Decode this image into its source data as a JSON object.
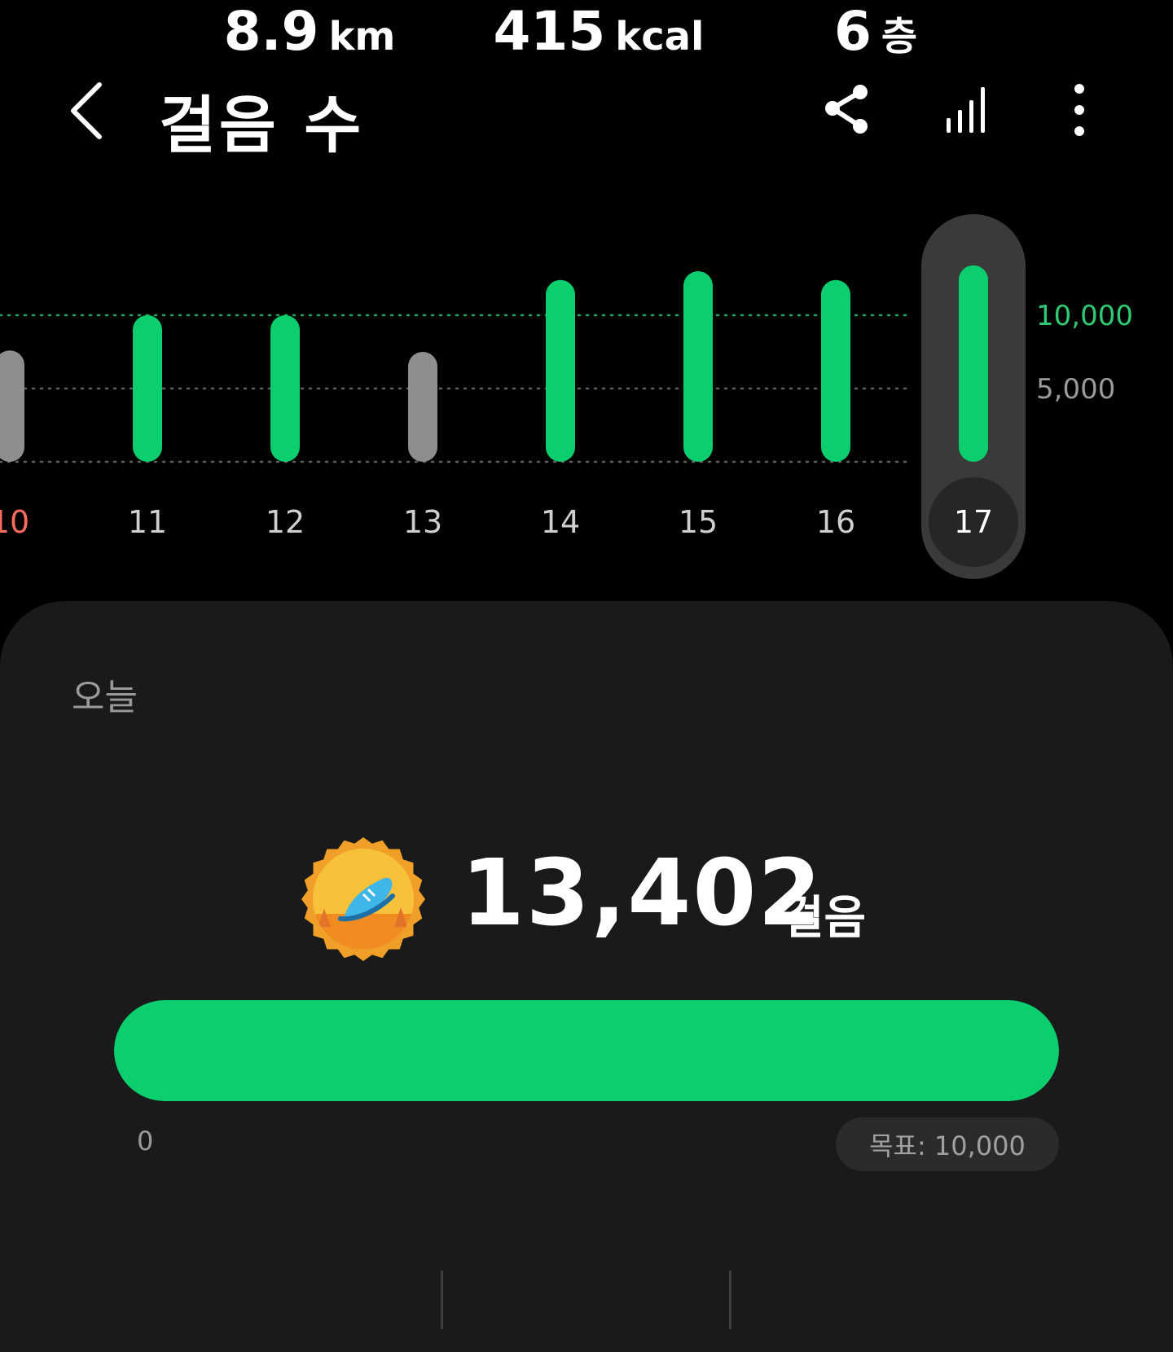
{
  "header": {
    "title": "걸음 수",
    "back_icon": "back-arrow-icon",
    "share_icon": "share-icon",
    "chart_icon": "bar-chart-icon",
    "more_icon": "more-vertical-icon"
  },
  "chart_data": {
    "type": "bar",
    "categories": [
      "10",
      "11",
      "12",
      "13",
      "14",
      "15",
      "16",
      "17"
    ],
    "values": [
      7600,
      10000,
      10000,
      7500,
      12400,
      13000,
      12400,
      13402
    ],
    "goal": 10000,
    "goal_met": [
      false,
      true,
      true,
      false,
      true,
      true,
      true,
      true
    ],
    "selected_index": 7,
    "y_tick_labels": [
      "10,000",
      "5,000"
    ],
    "y_ticks": [
      10000,
      5000,
      0
    ],
    "colors": {
      "goal_met": "#0bcf6e",
      "goal_missed": "#8e8e8e",
      "goal_label": "#2fcb74",
      "sunday_label": "#ff6b5e"
    }
  },
  "today": {
    "label": "오늘",
    "steps": "13,402",
    "unit": "걸음",
    "badge_icon": "running-shoe-badge-icon",
    "progress": 1.0,
    "progress_min": "0",
    "goal_label": "목표: 10,000"
  },
  "stats": [
    {
      "value": "8.9",
      "unit": "km"
    },
    {
      "value": "415",
      "unit": "kcal"
    },
    {
      "value": "6",
      "unit": "층"
    }
  ],
  "colors": {
    "accent": "#0bcf6e",
    "card": "#1a1a1a",
    "background": "#000000"
  }
}
